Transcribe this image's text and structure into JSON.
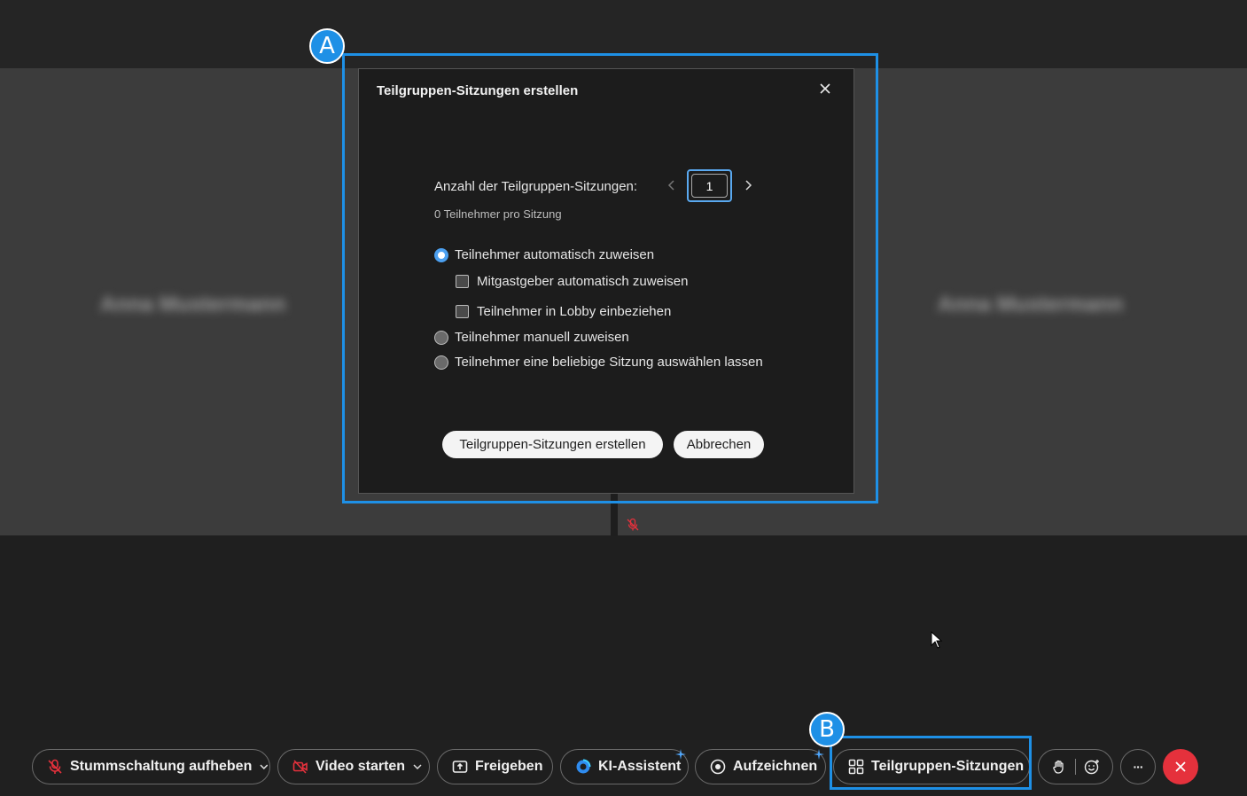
{
  "stage": {
    "left_participant_name": "Anna Mustermann",
    "right_participant_name": "Anna Mustermann"
  },
  "annotations": {
    "badge_a": "A",
    "badge_b": "B"
  },
  "dialog": {
    "title": "Teilgruppen-Sitzungen erstellen",
    "count_label": "Anzahl der Teilgruppen-Sitzungen:",
    "count_value": "1",
    "per_session_text": "0 Teilnehmer pro Sitzung",
    "options": {
      "auto_assign": "Teilnehmer automatisch zuweisen",
      "cohost_auto": "Mitgastgeber automatisch zuweisen",
      "include_lobby": "Teilnehmer in Lobby einbeziehen",
      "manual_assign": "Teilnehmer manuell zuweisen",
      "self_select": "Teilnehmer eine beliebige Sitzung auswählen lassen"
    },
    "selected_option": "auto_assign",
    "create_button": "Teilgruppen-Sitzungen erstellen",
    "cancel_button": "Abbrechen"
  },
  "toolbar": {
    "unmute": "Stummschaltung aufheben",
    "start_video": "Video starten",
    "share": "Freigeben",
    "ai_assistant": "KI-Assistent",
    "record": "Aufzeichnen",
    "breakout": "Teilgruppen-Sitzungen",
    "more": "···"
  },
  "colors": {
    "accent_blue": "#1e90e6",
    "muted_red": "#e5313c",
    "dialog_bg": "#1c1c1c"
  }
}
